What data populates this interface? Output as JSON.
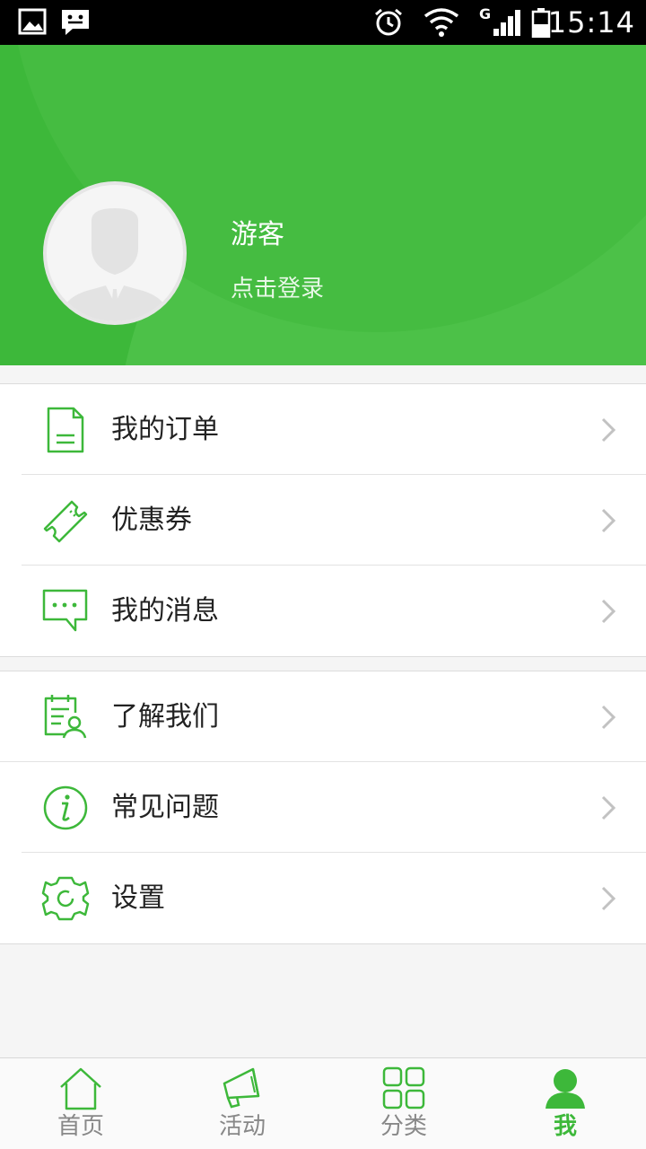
{
  "status_bar": {
    "time": "15:14",
    "icons": [
      "image-icon",
      "chat-notification-icon",
      "alarm-icon",
      "wifi-icon",
      "signal-icon",
      "battery-icon"
    ],
    "network": "G"
  },
  "profile": {
    "username": "游客",
    "login_prompt": "点击登录"
  },
  "menu_group_1": [
    {
      "label": "我的订单",
      "icon": "order-document-icon"
    },
    {
      "label": "优惠券",
      "icon": "coupon-ticket-icon"
    },
    {
      "label": "我的消息",
      "icon": "message-bubble-icon"
    }
  ],
  "menu_group_2": [
    {
      "label": "了解我们",
      "icon": "about-us-icon"
    },
    {
      "label": "常见问题",
      "icon": "info-icon"
    },
    {
      "label": "设置",
      "icon": "settings-gear-icon"
    }
  ],
  "bottom_nav": {
    "tabs": [
      {
        "label": "首页",
        "icon": "home-icon",
        "active": false
      },
      {
        "label": "活动",
        "icon": "megaphone-icon",
        "active": false
      },
      {
        "label": "分类",
        "icon": "category-grid-icon",
        "active": false
      },
      {
        "label": "我",
        "icon": "person-icon",
        "active": true
      }
    ]
  },
  "colors": {
    "accent": "#3db83a",
    "inactive": "#888888",
    "text": "#222222"
  }
}
